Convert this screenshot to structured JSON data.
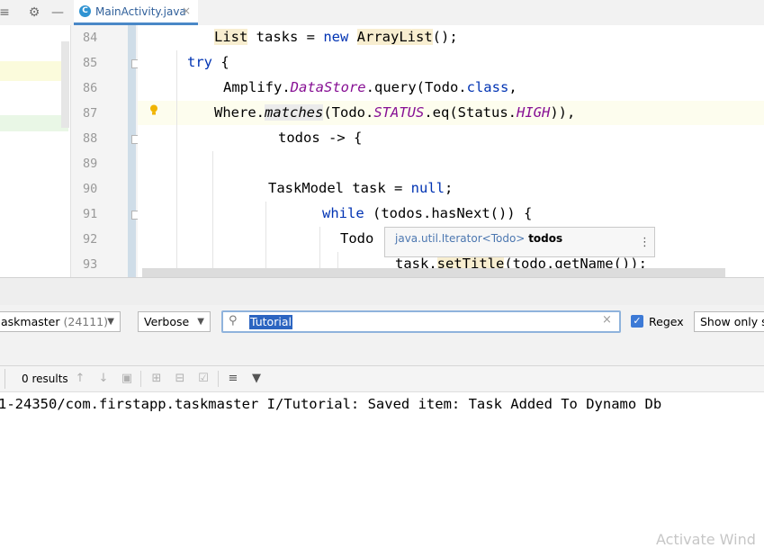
{
  "toolbar": {
    "icons": [
      "split-icon",
      "gear-icon",
      "minimize-icon"
    ]
  },
  "editor_tab": {
    "icon_letter": "C",
    "label": "MainActivity.java",
    "close": "×"
  },
  "gutter": {
    "line_numbers": [
      "84",
      "85",
      "86",
      "87",
      "88",
      "89",
      "90",
      "91",
      "92",
      "93"
    ]
  },
  "code": {
    "line84": {
      "a": "List",
      "b": " tasks = ",
      "c": "new",
      "d": " ",
      "e": "ArrayList",
      "f": "();"
    },
    "line85": {
      "a": "try",
      "b": " {"
    },
    "line86": {
      "a": "Amplify.",
      "b": "DataStore",
      "c": ".query(Todo.",
      "d": "class",
      "e": ","
    },
    "line87": {
      "a": "Where.",
      "b": "matches",
      "c": "(Todo.",
      "d": "STATUS",
      "e": ".eq(Status.",
      "f": "HIGH",
      "g": ")),"
    },
    "line88": {
      "a": "todos -> {"
    },
    "line90": {
      "a": "TaskModel task = ",
      "b": "null",
      "c": ";"
    },
    "line91": {
      "a": "while",
      "b": " (todos.hasNext()) {"
    },
    "line92": {
      "a": "Todo"
    },
    "line93": {
      "a": "task.",
      "b": "setTitle",
      "c": "(todo.getName());"
    }
  },
  "tooltip": {
    "type": "java.util.Iterator<Todo>",
    "name": "todos",
    "more": "⋮"
  },
  "logcat": {
    "process": {
      "name": "askmaster",
      "pid": "(24111)"
    },
    "level": "Verbose",
    "search": {
      "value": "Tutorial",
      "clear": "×"
    },
    "regex": {
      "checked": true,
      "label": "Regex"
    },
    "show_only": "Show only sel",
    "results": "0 results",
    "log_line": "1-24350/com.firstapp.taskmaster I/Tutorial: Saved item: Task Added To Dynamo Db"
  },
  "watermark": "Activate Wind",
  "colors": {
    "accent": "#4a88c7",
    "keyword": "#0033b3",
    "field": "#871094",
    "selection": "#2c65c1"
  }
}
